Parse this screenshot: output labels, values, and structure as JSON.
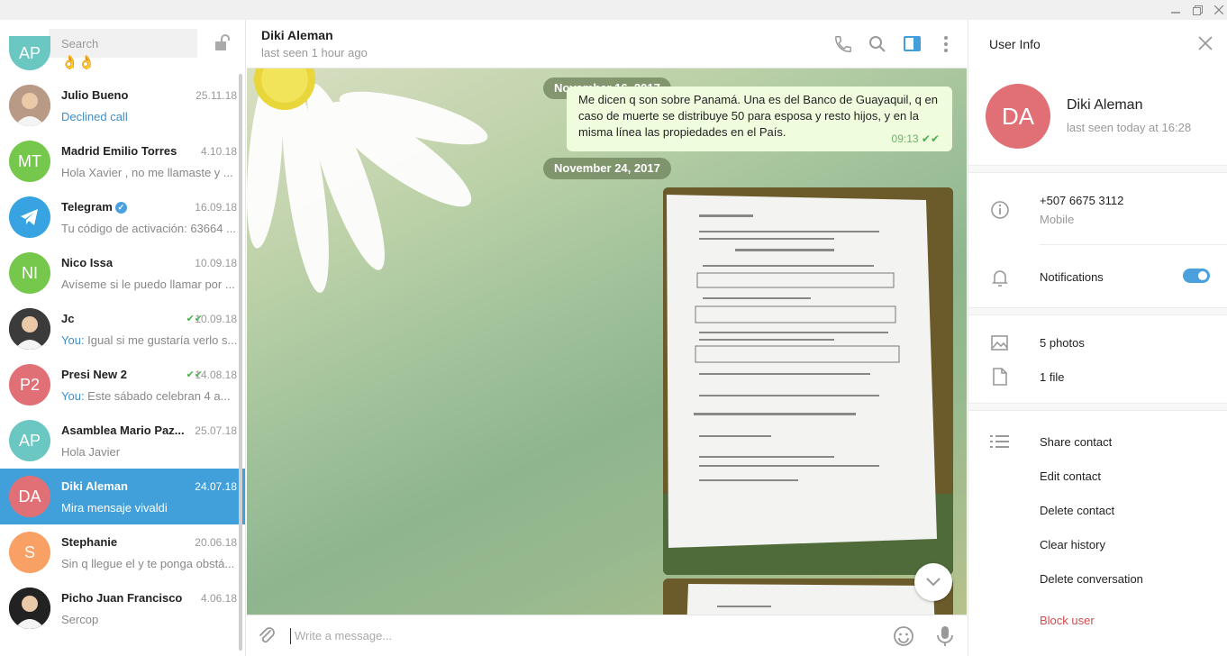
{
  "window": {
    "minimize_icon": "minimize-icon",
    "restore_icon": "restore-icon",
    "close_icon": "close-icon"
  },
  "sidebar": {
    "search_placeholder": "Search",
    "top_partial": {
      "avatar": "AP",
      "avatar_color": "#6bc7c2",
      "msg": "👌👌"
    },
    "chats": [
      {
        "avatar": "",
        "avatar_color": "#b89a86",
        "photo": true,
        "name": "Julio Bueno",
        "date": "25.11.18",
        "msg": "Declined call",
        "msg_style": "link"
      },
      {
        "avatar": "MT",
        "avatar_color": "#76c84d",
        "name": "Madrid Emilio Torres",
        "date": "4.10.18",
        "msg": "Hola Xavier , no me llamaste y ..."
      },
      {
        "avatar": "",
        "avatar_color": "#37a3e0",
        "telegram": true,
        "name": "Telegram",
        "verified": true,
        "date": "16.09.18",
        "msg": "Tu código de activación: 63664 ..."
      },
      {
        "avatar": "NI",
        "avatar_color": "#76c84d",
        "name": "Nico Issa",
        "date": "10.09.18",
        "msg": "Avíseme si le puedo llamar por ..."
      },
      {
        "avatar": "",
        "avatar_color": "#3b3b3b",
        "photo": true,
        "name": "Jc",
        "date": "10.09.18",
        "checks": true,
        "you": "You:",
        "msg": " Igual si me gustaría verlo s..."
      },
      {
        "avatar": "P2",
        "avatar_color": "#e17076",
        "name": "Presi New 2",
        "date": "14.08.18",
        "checks": true,
        "you": "You:",
        "msg": " Este sábado celebran 4 a..."
      },
      {
        "avatar": "AP",
        "avatar_color": "#6bc7c2",
        "name": "Asamblea Mario Paz...",
        "date": "25.07.18",
        "msg": "Hola Javier"
      },
      {
        "avatar": "DA",
        "avatar_color": "#e17076",
        "name": "Diki Aleman",
        "date": "24.07.18",
        "msg": "Mira mensaje vivaldi",
        "active": true
      },
      {
        "avatar": "S",
        "avatar_color": "#f9a064",
        "name": "Stephanie",
        "date": "20.06.18",
        "msg": "Sin q llegue el y te ponga obstá..."
      },
      {
        "avatar": "",
        "avatar_color": "#222222",
        "photo": true,
        "name": "Picho Juan Francisco",
        "date": "4.06.18",
        "msg": "Sercop"
      }
    ]
  },
  "header": {
    "title": "Diki Aleman",
    "status": "last seen 1 hour ago"
  },
  "conversation": {
    "date1": "November 16, 2017",
    "message": "Me dicen q son sobre Panamá. Una es del Banco de Guayaquil, q en caso de muerte se distribuye 50 para esposa y resto hijos, y en la misma línea las propiedades en el País.",
    "message_time": "09:13",
    "date2": "November 24, 2017"
  },
  "composer": {
    "placeholder": "Write a message..."
  },
  "info": {
    "title": "User Info",
    "avatar": "DA",
    "name": "Diki Aleman",
    "seen": "last seen today at 16:28",
    "phone": "+507 6675 3112",
    "phone_label": "Mobile",
    "notifications": "Notifications",
    "notifications_on": true,
    "photos": "5 photos",
    "files": "1 file",
    "actions": [
      "Share contact",
      "Edit contact",
      "Delete contact",
      "Clear history",
      "Delete conversation"
    ],
    "block": "Block user"
  },
  "colors": {
    "accent": "#419fd9",
    "bubble": "#effdde",
    "danger": "#d14e4e"
  }
}
